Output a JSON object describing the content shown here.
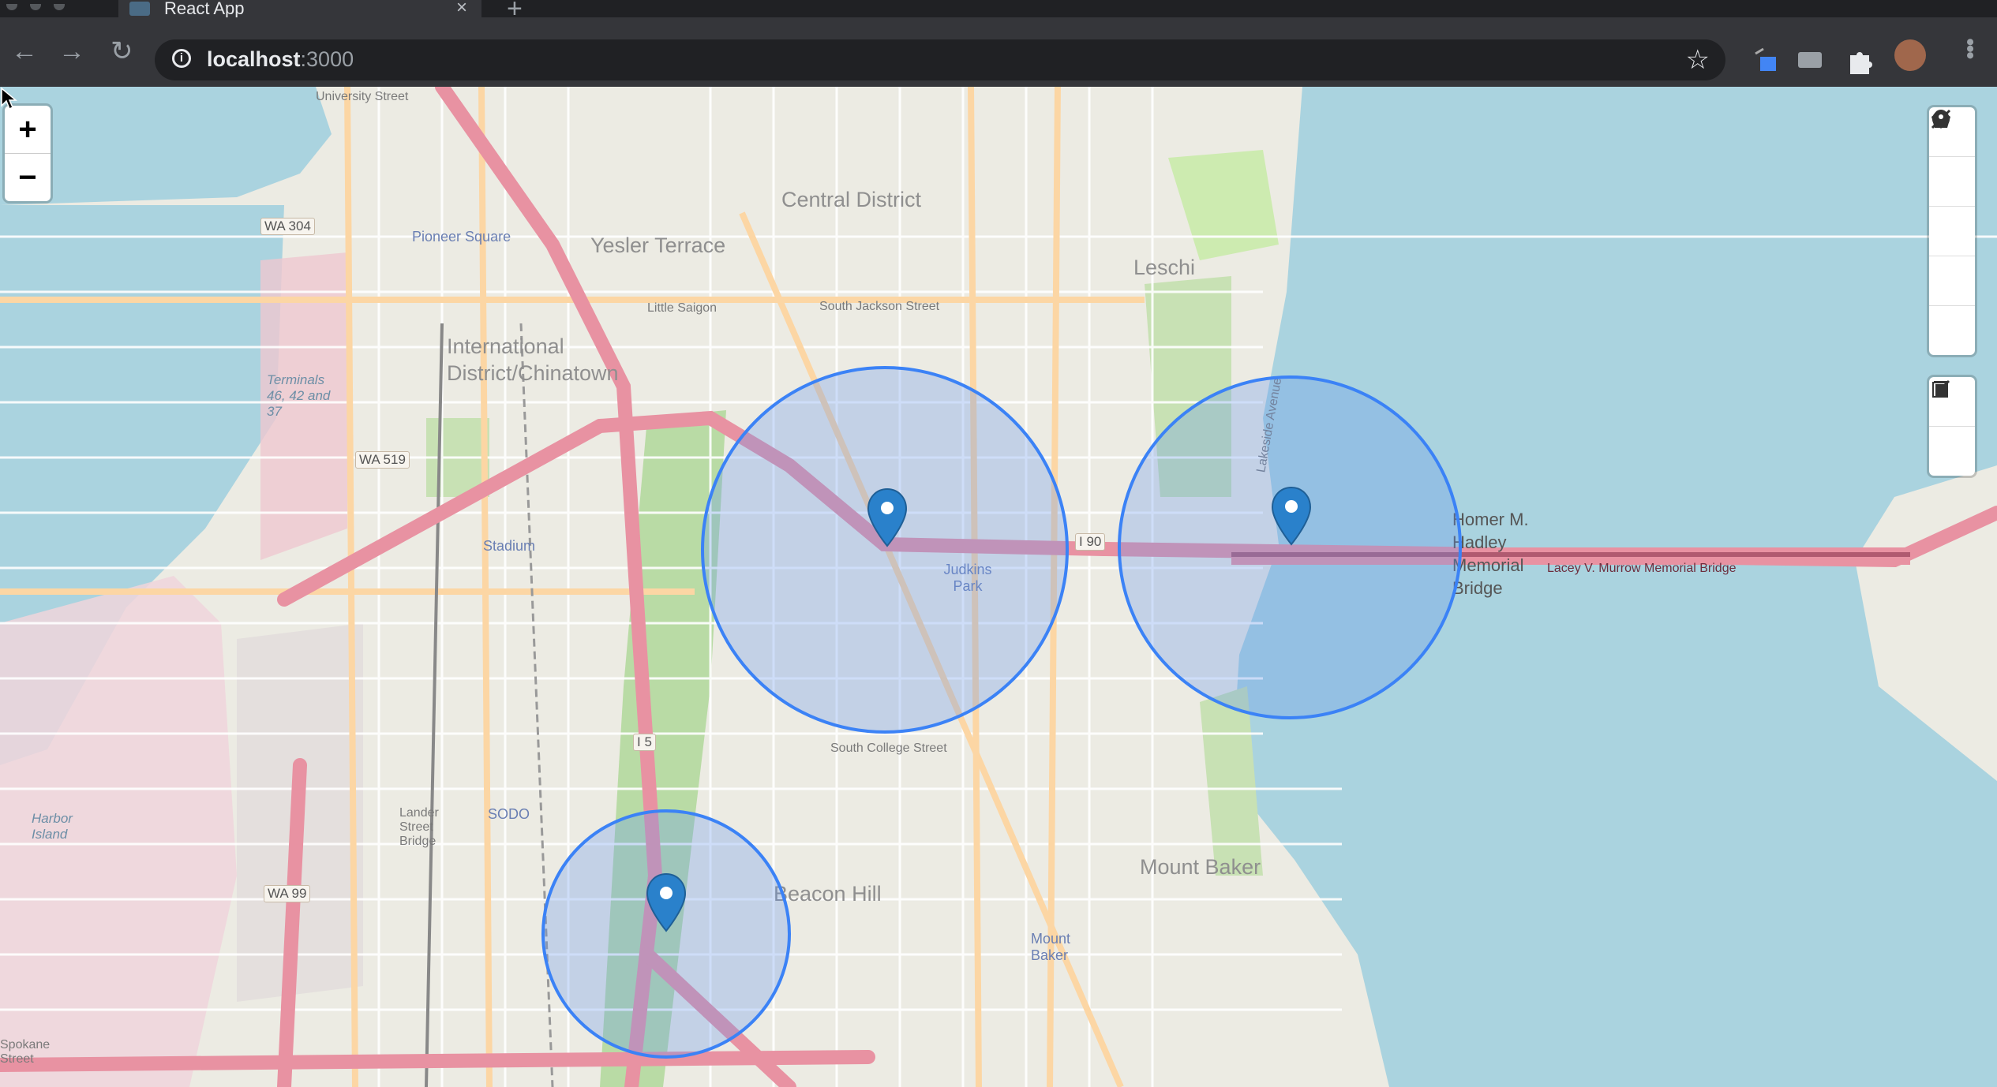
{
  "browser": {
    "tab_title": "React App",
    "tab_close": "×",
    "new_tab": "+",
    "url_host": "localhost",
    "url_port": ":3000"
  },
  "map": {
    "zoom_in": "+",
    "zoom_out": "−",
    "labels": {
      "university_street": "University Street",
      "central_district": "Central District",
      "yesler_terrace": "Yesler Terrace",
      "leschi": "Leschi",
      "pioneer_square": "Pioneer Square",
      "little_saigon": "Little Saigon",
      "south_jackson": "South Jackson Street",
      "intl_district": "International District/Chinatown",
      "terminals": "Terminals 46, 42 and 37",
      "stadium": "Stadium",
      "judkins_park": "Judkins Park",
      "homer_bridge": "Homer M. Hadley Memorial Bridge",
      "lacey_bridge": "Lacey V. Murrow Memorial Bridge",
      "south_college": "South College Street",
      "beacon_hill": "Beacon Hill",
      "mount_baker": "Mount Baker",
      "mount_baker_station": "Mount Baker",
      "harbor_island": "Harbor Island",
      "lander_bridge": "Lander Street Bridge",
      "sodo": "SODO",
      "spokane": "Spokane Street",
      "lakeside": "Lakeside Avenue",
      "wa304": "WA 304",
      "wa519": "WA 519",
      "wa99": "WA 99",
      "i90": "I 90",
      "i5": "I 5"
    }
  },
  "colors": {
    "water": "#aad3df",
    "land": "#ecebe3",
    "motorway": "#e892a2",
    "primary": "#fcd6a4",
    "circle": "#3b82f6",
    "marker": "#2a81cb"
  },
  "icons": {
    "draw_tools": [
      "polyline-icon",
      "polygon-icon",
      "circle-filled-icon",
      "marker-icon",
      "circle-icon"
    ],
    "edit_tools": [
      "edit-icon",
      "trash-icon"
    ]
  }
}
